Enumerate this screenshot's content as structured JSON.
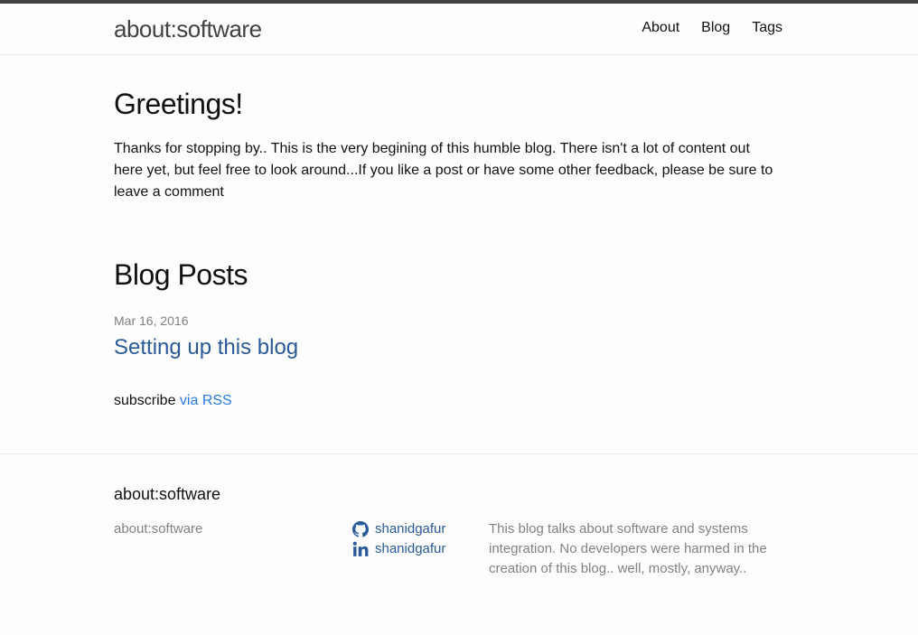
{
  "header": {
    "site_title": "about:software",
    "nav": [
      {
        "label": "About"
      },
      {
        "label": "Blog"
      },
      {
        "label": "Tags"
      }
    ]
  },
  "intro": {
    "title": "Greetings!",
    "text": "Thanks for stopping by.. This is the very begining of this humble blog. There isn't a lot of content out here yet, but feel free to look around...If you like a post or have some other feedback, please be sure to leave a comment"
  },
  "posts_section": {
    "title": "Blog Posts",
    "posts": [
      {
        "date": "Mar 16, 2016",
        "title": "Setting up this blog"
      }
    ],
    "subscribe_prefix": "subscribe ",
    "subscribe_link": "via RSS"
  },
  "footer": {
    "heading": "about:software",
    "site_name": "about:software",
    "social": [
      {
        "icon": "github-icon",
        "username": "shanidgafur"
      },
      {
        "icon": "linkedin-icon",
        "username": "shanidgafur"
      }
    ],
    "description": "This blog talks about software and systems integration. No developers were harmed in the creation of this blog.. well, mostly, anyway.."
  },
  "colors": {
    "accent_link": "#2a7ae2",
    "dark_link": "#2a5a9a",
    "top_border": "#424242",
    "muted_text": "#828282"
  }
}
